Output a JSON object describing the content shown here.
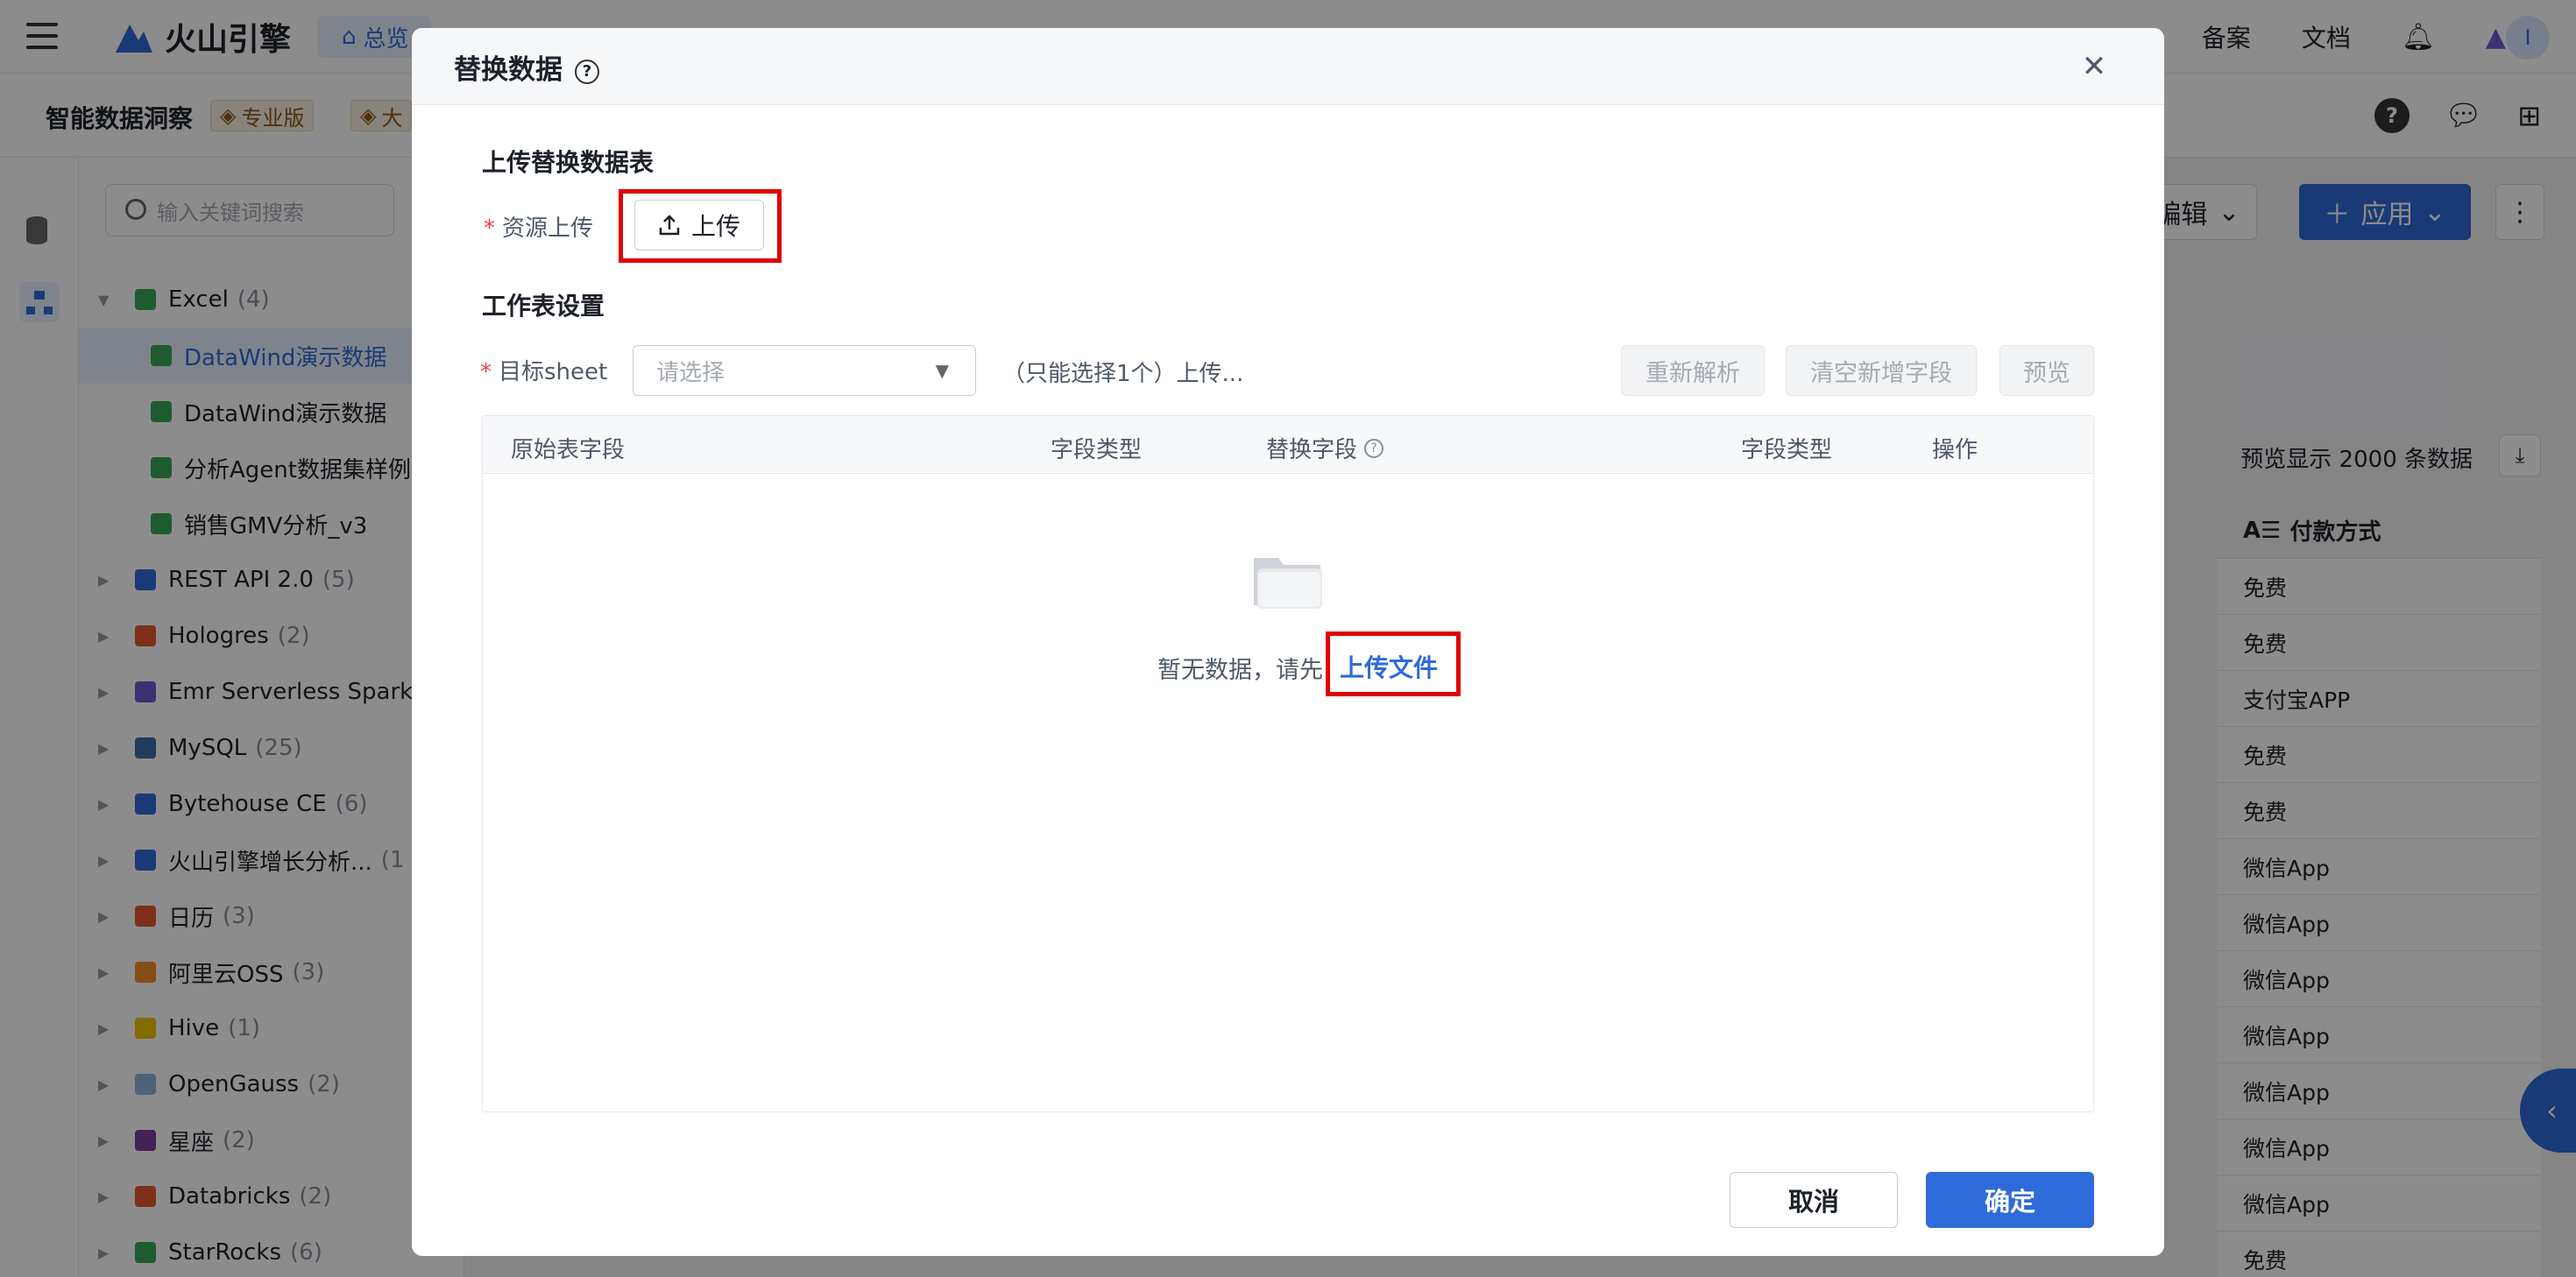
{
  "topnav": {
    "logo_text": "火山引擎",
    "home_label": "总览",
    "links": [
      "备案",
      "文档"
    ],
    "avatar_letter": "I"
  },
  "subbar": {
    "title": "智能数据洞察",
    "edition_badge": "专业版",
    "second_badge": "大"
  },
  "tree": {
    "search_placeholder": "输入关键词搜索",
    "items": [
      {
        "label": "Excel",
        "count": "(4)",
        "color": "#3aa655"
      },
      {
        "label": "DataWind演示数据",
        "count": "",
        "color": "#3aa655"
      },
      {
        "label": "DataWind演示数据",
        "count": "",
        "color": "#3aa655"
      },
      {
        "label": "分析Agent数据集样例",
        "count": "",
        "color": "#3aa655"
      },
      {
        "label": "销售GMV分析_v3",
        "count": "",
        "color": "#3aa655"
      },
      {
        "label": "REST API 2.0",
        "count": "(5)",
        "color": "#2f6bd8"
      },
      {
        "label": "Hologres",
        "count": "(2)",
        "color": "#e4572e"
      },
      {
        "label": "Emr Serverless Spark",
        "count": "(",
        "color": "#6b5bd2"
      },
      {
        "label": "MySQL",
        "count": "(25)",
        "color": "#3a6ea5"
      },
      {
        "label": "Bytehouse CE",
        "count": "(6)",
        "color": "#2f6bd8"
      },
      {
        "label": "火山引擎增长分析...",
        "count": "(1",
        "color": "#2f6bd8"
      },
      {
        "label": "日历",
        "count": "(3)",
        "color": "#e4572e"
      },
      {
        "label": "阿里云OSS",
        "count": "(3)",
        "color": "#f28c28"
      },
      {
        "label": "Hive",
        "count": "(1)",
        "color": "#f2c200"
      },
      {
        "label": "OpenGauss",
        "count": "(2)",
        "color": "#8fb3d9"
      },
      {
        "label": "星座",
        "count": "(2)",
        "color": "#7b3fa0"
      },
      {
        "label": "Databricks",
        "count": "(2)",
        "color": "#e4572e"
      },
      {
        "label": "StarRocks",
        "count": "(6)",
        "color": "#3aa655"
      }
    ]
  },
  "main": {
    "edit_label": "编辑",
    "apply_label": "应用",
    "preview_note": "预览显示 2000 条数据",
    "table_header": "付款方式",
    "table_rows": [
      "免费",
      "免费",
      "支付宝APP",
      "免费",
      "免费",
      "微信App",
      "微信App",
      "微信App",
      "微信App",
      "微信App",
      "微信App",
      "微信App",
      "免费"
    ]
  },
  "modal": {
    "title": "替换数据",
    "section_upload": "上传替换数据表",
    "upload_label": "资源上传",
    "upload_button": "上传",
    "section_sheet": "工作表设置",
    "target_label": "目标sheet",
    "select_placeholder": "请选择",
    "hint": "（只能选择1个）上传...",
    "btn_reparse": "重新解析",
    "btn_clear": "清空新增字段",
    "btn_preview": "预览",
    "columns": {
      "orig_field": "原始表字段",
      "field_type_1": "字段类型",
      "replace_field": "替换字段",
      "field_type_2": "字段类型",
      "action": "操作"
    },
    "empty_text": "暂无数据，请先",
    "empty_link": "上传文件",
    "cancel": "取消",
    "confirm": "确定"
  },
  "colors": {
    "primary": "#2f6bd8",
    "highlight_box": "#e00000",
    "required": "#f53f3f"
  }
}
